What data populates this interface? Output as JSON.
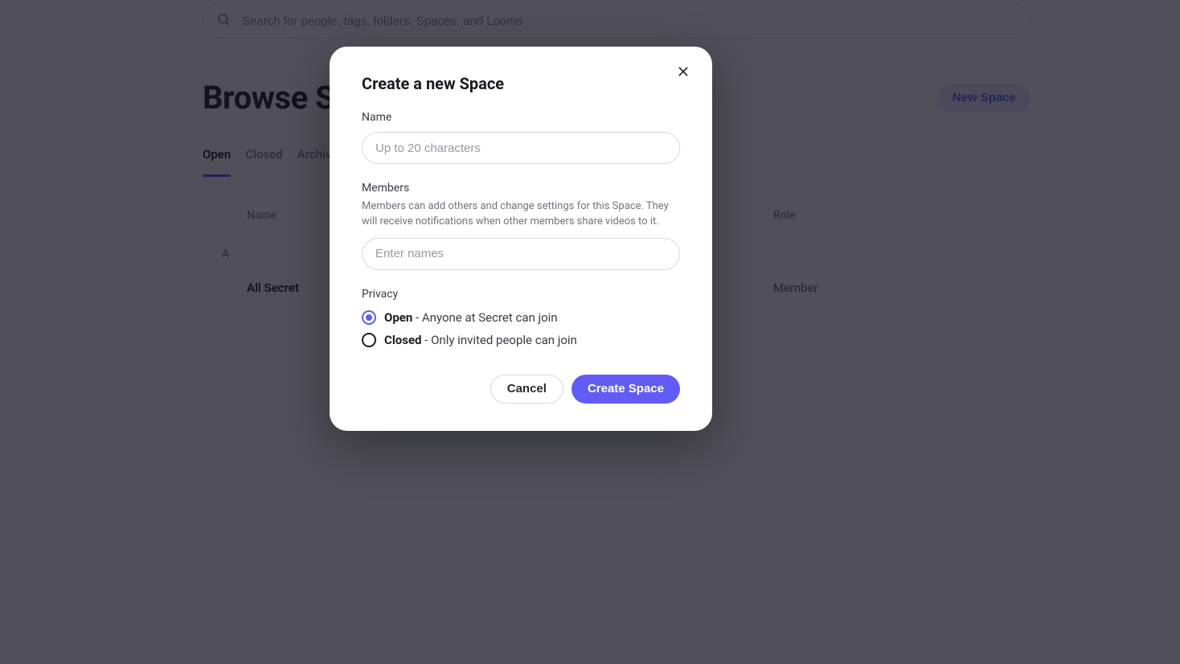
{
  "search": {
    "placeholder": "Search for people, tags, folders, Spaces, and Looms"
  },
  "header": {
    "title": "Browse Spaces",
    "new_space_label": "New Space"
  },
  "tabs": [
    {
      "label": "Open",
      "active": true
    },
    {
      "label": "Closed",
      "active": false
    },
    {
      "label": "Archived",
      "active": false
    }
  ],
  "table": {
    "columns": {
      "name": "Name",
      "role": "Role"
    },
    "groups": [
      {
        "letter": "A",
        "rows": [
          {
            "name": "All Secret",
            "role": "Member"
          }
        ]
      }
    ]
  },
  "modal": {
    "title": "Create a new Space",
    "name_label": "Name",
    "name_placeholder": "Up to 20 characters",
    "members_label": "Members",
    "members_help": "Members can add others and change settings for this Space. They will receive notifications when other members share videos to it.",
    "members_placeholder": "Enter names",
    "privacy_label": "Privacy",
    "privacy_options": [
      {
        "key": "open",
        "strong": "Open",
        "rest": " - Anyone at Secret can join",
        "selected": true
      },
      {
        "key": "closed",
        "strong": "Closed",
        "rest": " - Only invited people can join",
        "selected": false
      }
    ],
    "cancel_label": "Cancel",
    "submit_label": "Create Space"
  },
  "colors": {
    "accent": "#615cf5"
  }
}
